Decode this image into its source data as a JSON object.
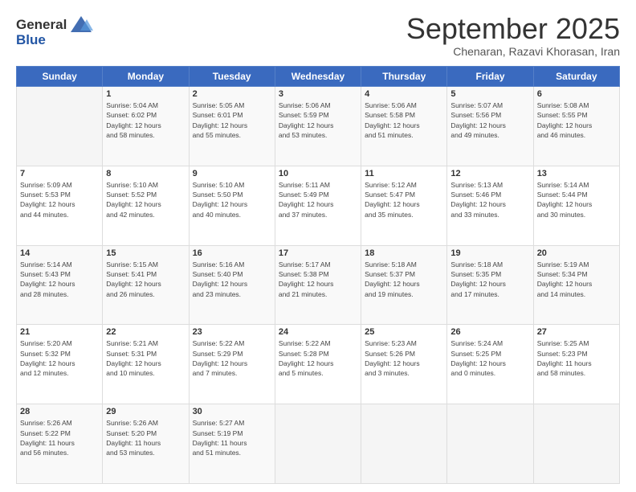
{
  "logo": {
    "line1": "General",
    "line2": "Blue"
  },
  "title": "September 2025",
  "subtitle": "Chenaran, Razavi Khorasan, Iran",
  "header_days": [
    "Sunday",
    "Monday",
    "Tuesday",
    "Wednesday",
    "Thursday",
    "Friday",
    "Saturday"
  ],
  "weeks": [
    [
      {
        "day": "",
        "info": ""
      },
      {
        "day": "1",
        "info": "Sunrise: 5:04 AM\nSunset: 6:02 PM\nDaylight: 12 hours\nand 58 minutes."
      },
      {
        "day": "2",
        "info": "Sunrise: 5:05 AM\nSunset: 6:01 PM\nDaylight: 12 hours\nand 55 minutes."
      },
      {
        "day": "3",
        "info": "Sunrise: 5:06 AM\nSunset: 5:59 PM\nDaylight: 12 hours\nand 53 minutes."
      },
      {
        "day": "4",
        "info": "Sunrise: 5:06 AM\nSunset: 5:58 PM\nDaylight: 12 hours\nand 51 minutes."
      },
      {
        "day": "5",
        "info": "Sunrise: 5:07 AM\nSunset: 5:56 PM\nDaylight: 12 hours\nand 49 minutes."
      },
      {
        "day": "6",
        "info": "Sunrise: 5:08 AM\nSunset: 5:55 PM\nDaylight: 12 hours\nand 46 minutes."
      }
    ],
    [
      {
        "day": "7",
        "info": "Sunrise: 5:09 AM\nSunset: 5:53 PM\nDaylight: 12 hours\nand 44 minutes."
      },
      {
        "day": "8",
        "info": "Sunrise: 5:10 AM\nSunset: 5:52 PM\nDaylight: 12 hours\nand 42 minutes."
      },
      {
        "day": "9",
        "info": "Sunrise: 5:10 AM\nSunset: 5:50 PM\nDaylight: 12 hours\nand 40 minutes."
      },
      {
        "day": "10",
        "info": "Sunrise: 5:11 AM\nSunset: 5:49 PM\nDaylight: 12 hours\nand 37 minutes."
      },
      {
        "day": "11",
        "info": "Sunrise: 5:12 AM\nSunset: 5:47 PM\nDaylight: 12 hours\nand 35 minutes."
      },
      {
        "day": "12",
        "info": "Sunrise: 5:13 AM\nSunset: 5:46 PM\nDaylight: 12 hours\nand 33 minutes."
      },
      {
        "day": "13",
        "info": "Sunrise: 5:14 AM\nSunset: 5:44 PM\nDaylight: 12 hours\nand 30 minutes."
      }
    ],
    [
      {
        "day": "14",
        "info": "Sunrise: 5:14 AM\nSunset: 5:43 PM\nDaylight: 12 hours\nand 28 minutes."
      },
      {
        "day": "15",
        "info": "Sunrise: 5:15 AM\nSunset: 5:41 PM\nDaylight: 12 hours\nand 26 minutes."
      },
      {
        "day": "16",
        "info": "Sunrise: 5:16 AM\nSunset: 5:40 PM\nDaylight: 12 hours\nand 23 minutes."
      },
      {
        "day": "17",
        "info": "Sunrise: 5:17 AM\nSunset: 5:38 PM\nDaylight: 12 hours\nand 21 minutes."
      },
      {
        "day": "18",
        "info": "Sunrise: 5:18 AM\nSunset: 5:37 PM\nDaylight: 12 hours\nand 19 minutes."
      },
      {
        "day": "19",
        "info": "Sunrise: 5:18 AM\nSunset: 5:35 PM\nDaylight: 12 hours\nand 17 minutes."
      },
      {
        "day": "20",
        "info": "Sunrise: 5:19 AM\nSunset: 5:34 PM\nDaylight: 12 hours\nand 14 minutes."
      }
    ],
    [
      {
        "day": "21",
        "info": "Sunrise: 5:20 AM\nSunset: 5:32 PM\nDaylight: 12 hours\nand 12 minutes."
      },
      {
        "day": "22",
        "info": "Sunrise: 5:21 AM\nSunset: 5:31 PM\nDaylight: 12 hours\nand 10 minutes."
      },
      {
        "day": "23",
        "info": "Sunrise: 5:22 AM\nSunset: 5:29 PM\nDaylight: 12 hours\nand 7 minutes."
      },
      {
        "day": "24",
        "info": "Sunrise: 5:22 AM\nSunset: 5:28 PM\nDaylight: 12 hours\nand 5 minutes."
      },
      {
        "day": "25",
        "info": "Sunrise: 5:23 AM\nSunset: 5:26 PM\nDaylight: 12 hours\nand 3 minutes."
      },
      {
        "day": "26",
        "info": "Sunrise: 5:24 AM\nSunset: 5:25 PM\nDaylight: 12 hours\nand 0 minutes."
      },
      {
        "day": "27",
        "info": "Sunrise: 5:25 AM\nSunset: 5:23 PM\nDaylight: 11 hours\nand 58 minutes."
      }
    ],
    [
      {
        "day": "28",
        "info": "Sunrise: 5:26 AM\nSunset: 5:22 PM\nDaylight: 11 hours\nand 56 minutes."
      },
      {
        "day": "29",
        "info": "Sunrise: 5:26 AM\nSunset: 5:20 PM\nDaylight: 11 hours\nand 53 minutes."
      },
      {
        "day": "30",
        "info": "Sunrise: 5:27 AM\nSunset: 5:19 PM\nDaylight: 11 hours\nand 51 minutes."
      },
      {
        "day": "",
        "info": ""
      },
      {
        "day": "",
        "info": ""
      },
      {
        "day": "",
        "info": ""
      },
      {
        "day": "",
        "info": ""
      }
    ]
  ]
}
